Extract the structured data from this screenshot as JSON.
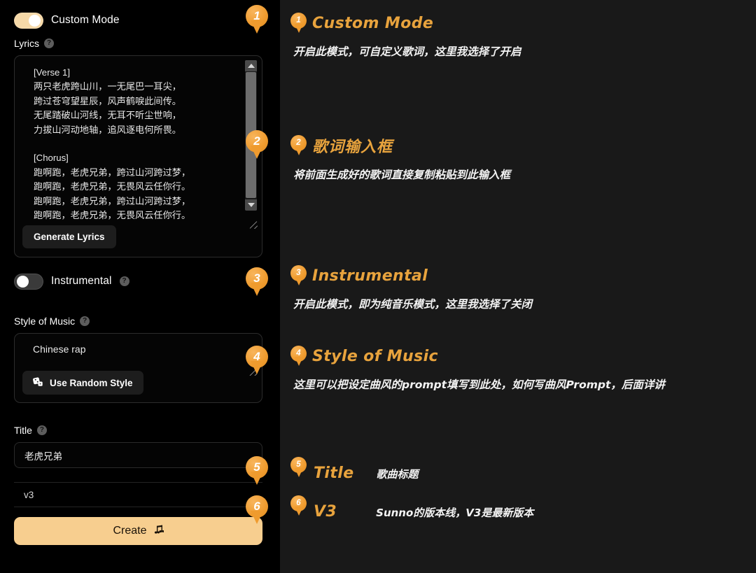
{
  "left": {
    "custom_mode": {
      "label": "Custom Mode",
      "state": "on"
    },
    "lyrics": {
      "label": "Lyrics",
      "text": "[Verse 1]\n两只老虎跨山川，一无尾巴一耳尖，\n跨过苍穹望星辰，风声鹤唳此间传。\n无尾踏破山河线，无耳不听尘世响，\n力拔山河动地轴，追风逐电何所畏。\n\n[Chorus]\n跑啊跑，老虎兄弟，跨过山河跨过梦，\n跑啊跑，老虎兄弟，无畏风云任你行。\n跑啊跑，老虎兄弟，跨过山河跨过梦，\n跑啊跑，老虎兄弟，无畏风云任你行。",
      "generate_button": "Generate Lyrics"
    },
    "instrumental": {
      "label": "Instrumental",
      "state": "off"
    },
    "style_of_music": {
      "label": "Style of Music",
      "value": "Chinese rap",
      "random_button": "Use Random Style",
      "random_icon": "dice-icon"
    },
    "title": {
      "label": "Title",
      "value": "老虎兄弟"
    },
    "version": {
      "value": "v3"
    },
    "create_button": {
      "label": "Create",
      "icon": "music-note-icon"
    },
    "help_icon_glyph": "?"
  },
  "pins": {
    "p1": "1",
    "p2": "2",
    "p3": "3",
    "p4": "4",
    "p5": "5",
    "p6": "6"
  },
  "notes": [
    {
      "num": "1",
      "title": "Custom Mode",
      "body": "开启此模式，可自定义歌词，这里我选择了开启"
    },
    {
      "num": "2",
      "title": "歌词输入框",
      "body": "将前面生成好的歌词直接复制粘贴到此输入框"
    },
    {
      "num": "3",
      "title": "Instrumental",
      "body": "开启此模式，即为纯音乐模式，这里我选择了关闭"
    },
    {
      "num": "4",
      "title": "Style of Music",
      "body": "这里可以把设定曲风的prompt填写到此处，如何写曲风Prompt，后面详讲"
    },
    {
      "num": "5",
      "title": "Title",
      "body": "歌曲标题"
    },
    {
      "num": "6",
      "title": "V3",
      "body": "Sunno的版本线，V3是最新版本"
    }
  ],
  "colors": {
    "accent": "#e8a33d",
    "pin": "#ef9b2e",
    "create_button": "#f7ce8f",
    "left_bg": "#000000",
    "right_bg": "#191919"
  }
}
